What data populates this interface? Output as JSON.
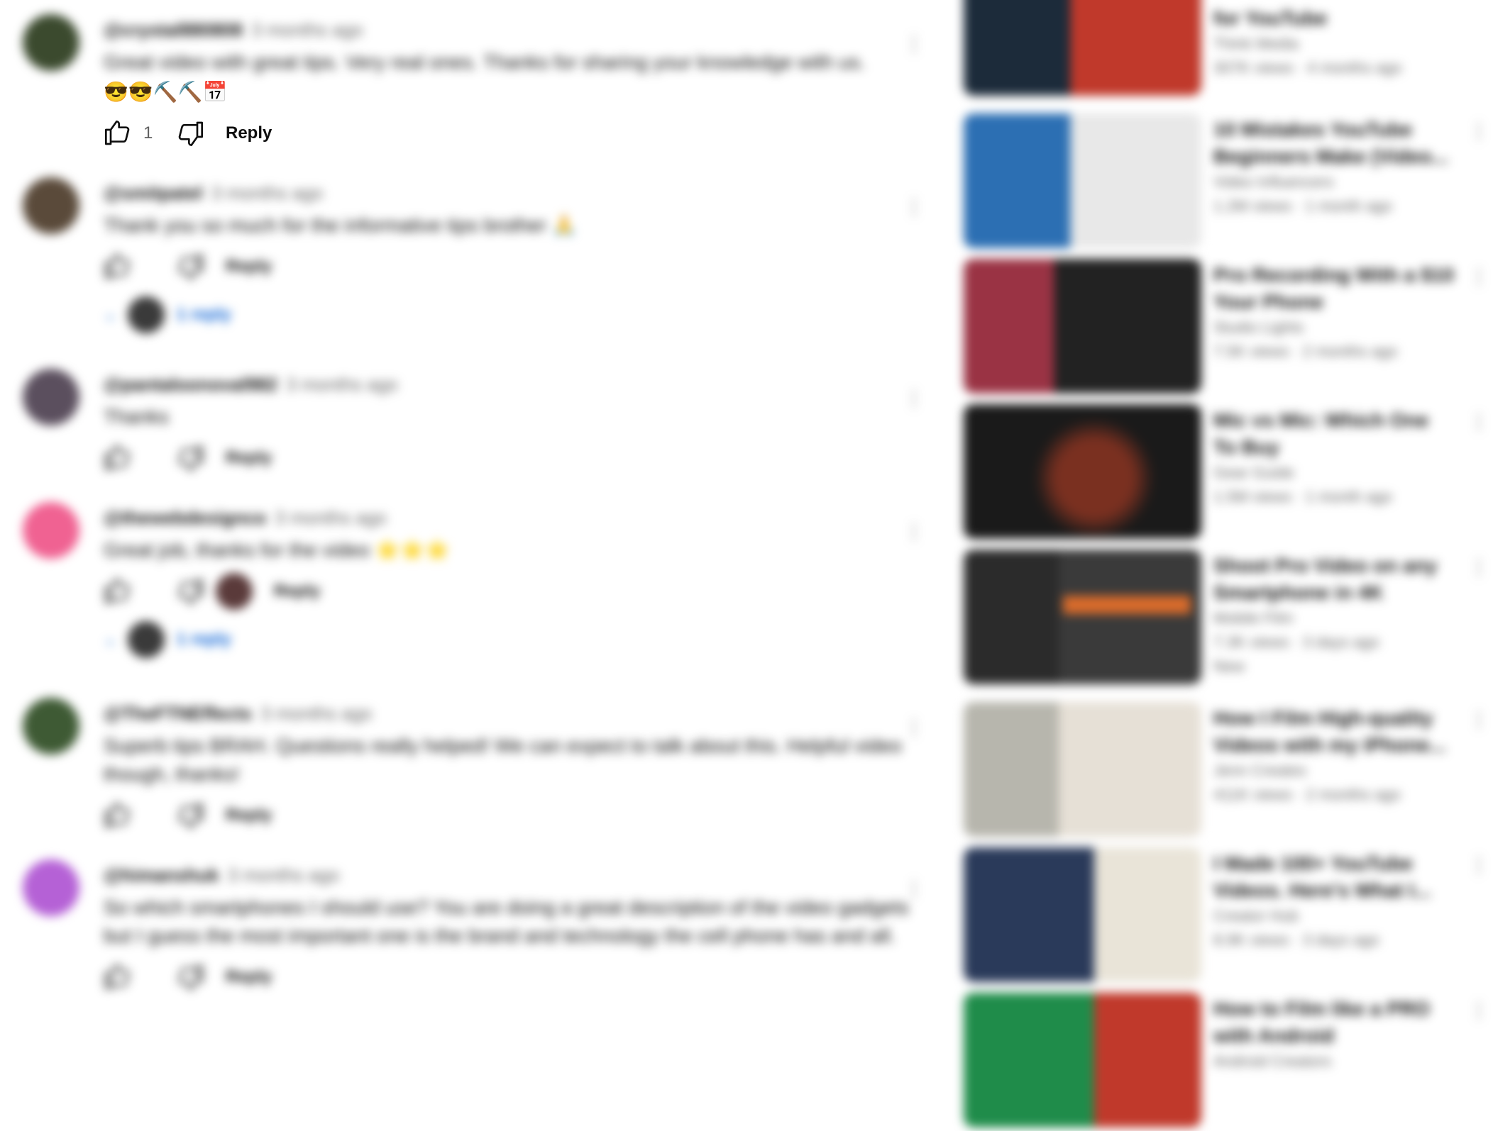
{
  "comments": [
    {
      "author": "@crystal880808",
      "time": "3 months ago",
      "text": "Great video with great tips. Very real ones. Thanks for sharing your knowledge with us.",
      "emoji_line": "😎😎⛏️⛏️📅",
      "likes": "1",
      "reply_label": "Reply",
      "avatar_color": "#3b4a2e",
      "replies": ""
    },
    {
      "author": "@smitpatel",
      "time": "3 months ago",
      "text": "Thank you so much for the informative tips brother 🙏",
      "likes": "",
      "reply_label": "Reply",
      "avatar_color": "#5a4a3a",
      "replies": "1 reply"
    },
    {
      "author": "@pantaloonoval982",
      "time": "3 months ago",
      "text": "Thanks",
      "likes": "",
      "reply_label": "Reply",
      "avatar_color": "#5b4f5e",
      "replies": ""
    },
    {
      "author": "@thewebdesignco",
      "time": "3 months ago",
      "text": "Great job, thanks for the video ⭐⭐⭐",
      "likes": "",
      "reply_label": "Reply",
      "avatar_color": "#f06292",
      "replies": "1 reply"
    },
    {
      "author": "@TheFTNEffects",
      "time": "3 months ago",
      "text": "Superb tips BRAH. Questions really helped! We can expect to talk about this. Helpful video though, thanks!",
      "likes": "",
      "reply_label": "Reply",
      "avatar_color": "#3e5a34",
      "replies": ""
    },
    {
      "author": "@himanshuk",
      "time": "3 months ago",
      "text": "So which smartphones I should use? You are doing a great description of the video gadgets but I guess the most important one is the brand and technology the cell phone has and all.",
      "likes": "",
      "reply_label": "Reply",
      "avatar_color": "#b561d6",
      "replies": ""
    }
  ],
  "videos": [
    {
      "title": "for YouTube",
      "channel": "Think Media",
      "meta": "307K views · 4 months ago",
      "badge": "",
      "colors": [
        "#1c2b3a",
        "#c0392b"
      ]
    },
    {
      "title": "10 Mistakes YouTube Beginners Make (Video...",
      "channel": "Video Influencers",
      "meta": "1.2M views · 1 month ago",
      "badge": "",
      "colors": [
        "#2c6fb3",
        "#e8e8e8"
      ]
    },
    {
      "title": "Pro Recording With a $10 Your Phone",
      "channel": "Studio Lights",
      "meta": "7.5K views · 2 months ago",
      "badge": "",
      "colors": [
        "#9a3344",
        "#222222"
      ]
    },
    {
      "title": "Mic vs Mic: Which One To Buy",
      "channel": "Gear Guide",
      "meta": "1.5M views · 1 month ago",
      "badge": "",
      "colors": [
        "#1a1a1a",
        "#7a3020"
      ]
    },
    {
      "title": "Shoot Pro Video on any Smartphone in 4K",
      "channel": "Mobile Film",
      "meta": "7.3K views · 3 days ago",
      "badge": "New",
      "colors": [
        "#2b2b2b",
        "#d96b2b"
      ]
    },
    {
      "title": "How I Film High-quality Videos with my iPhone...",
      "channel": "Jenn Creates",
      "meta": "411K views · 2 months ago",
      "badge": "",
      "colors": [
        "#b7b6ad",
        "#e6e0d6"
      ]
    },
    {
      "title": "I Made 100+ YouTube Videos. Here's What I...",
      "channel": "Creator Hub",
      "meta": "8.9K views · 3 days ago",
      "badge": "",
      "colors": [
        "#2a3a5a",
        "#e9e4d8"
      ]
    },
    {
      "title": "How to Film like a PRO with Android",
      "channel": "Android Creators",
      "meta": "",
      "badge": "",
      "colors": [
        "#1f8c4a",
        "#c0392b"
      ]
    }
  ]
}
